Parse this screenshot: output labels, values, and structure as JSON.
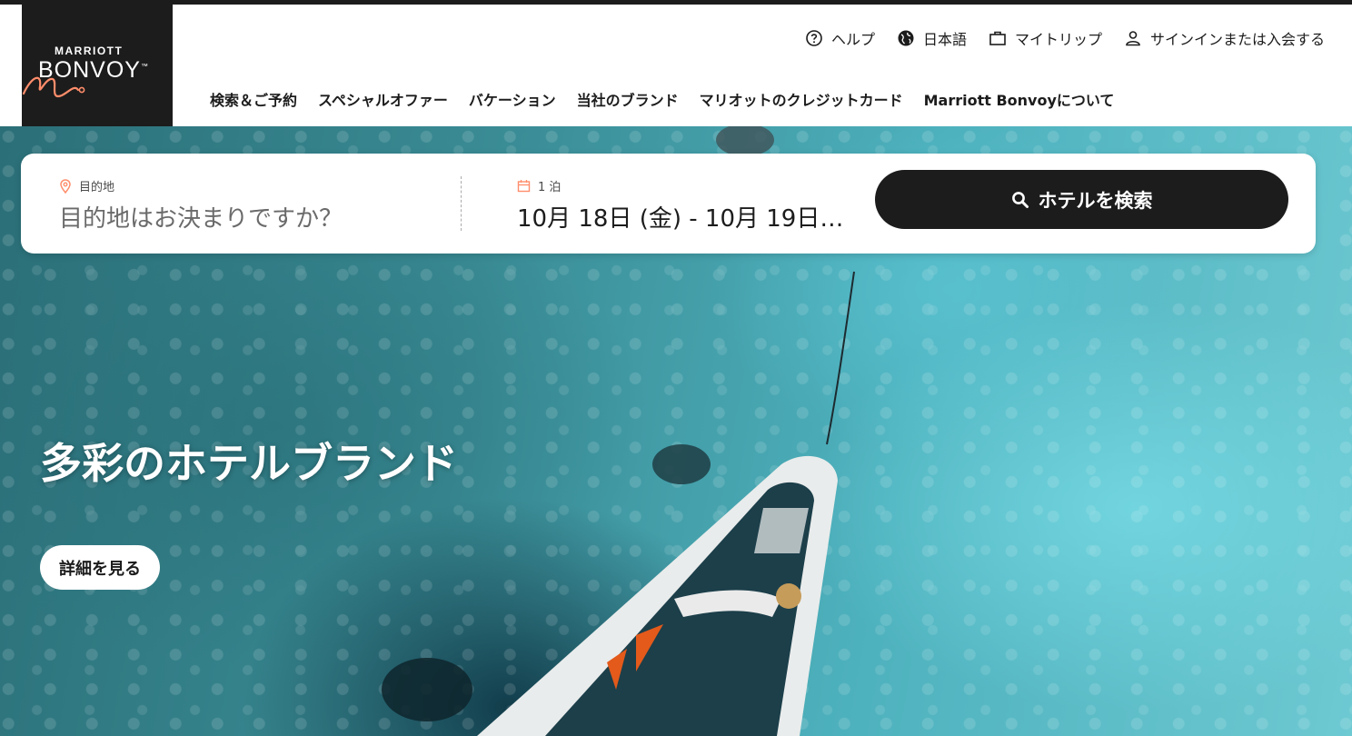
{
  "brand": {
    "logo_top": "MARRIOTT",
    "logo_main": "BONVOY",
    "logo_trademark": "™",
    "accent_color": "#ff8d6b",
    "dark_color": "#1c1c1c"
  },
  "utility_nav": [
    {
      "icon": "help-circle-icon",
      "label": "ヘルプ"
    },
    {
      "icon": "globe-icon",
      "label": "日本語"
    },
    {
      "icon": "suitcase-icon",
      "label": "マイトリップ"
    },
    {
      "icon": "user-icon",
      "label": "サインインまたは入会する"
    }
  ],
  "main_nav": [
    "検索＆ご予約",
    "スペシャルオファー",
    "バケーション",
    "当社のブランド",
    "マリオットのクレジットカード",
    "Marriott Bonvoyについて"
  ],
  "search": {
    "destination_label": "目的地",
    "destination_placeholder": "目的地はお決まりですか？",
    "nights_label": "1 泊",
    "dates_value": "10月 18日 (金) - 10月 19日…",
    "button_label": "ホテルを検索",
    "icons": {
      "destination": "map-pin-icon",
      "dates": "calendar-icon",
      "button": "search-icon"
    }
  },
  "hero": {
    "headline": "多彩のホテルブランド",
    "cta_label": "詳細を見る"
  }
}
